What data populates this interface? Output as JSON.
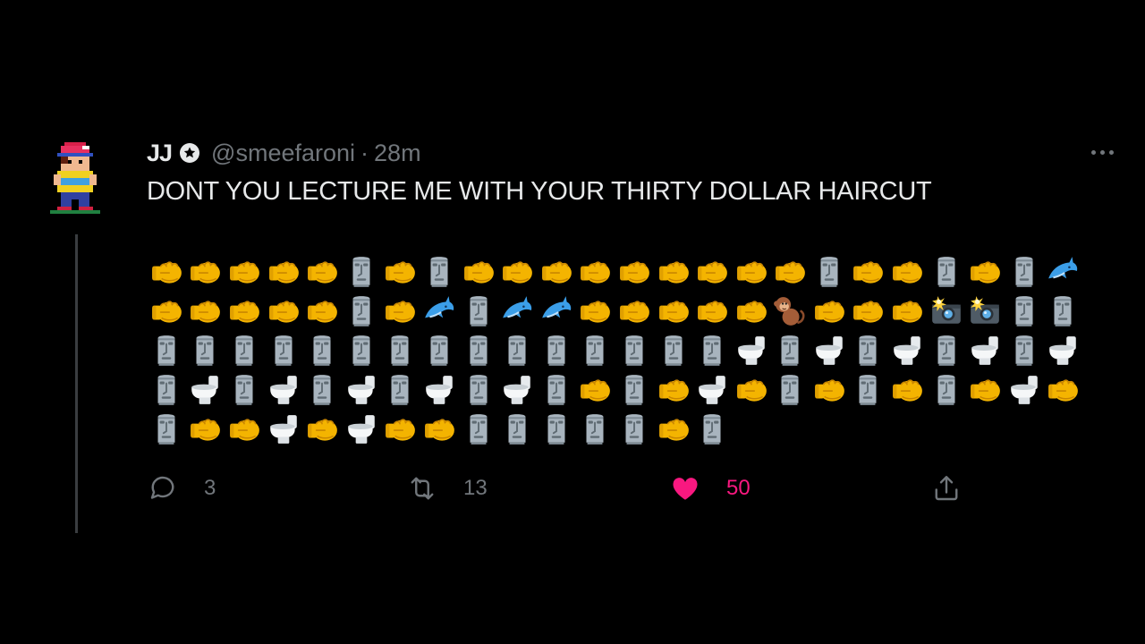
{
  "tweet": {
    "display_name": "JJ",
    "handle": "@smeefaroni",
    "separator": "·",
    "time": "28m",
    "text": "DONT YOU LECTURE ME WITH YOUR THIRTY DOLLAR HAIRCUT",
    "emoji_rows": [
      [
        "fist",
        "fist",
        "fist",
        "fist",
        "fist",
        "moai",
        "fist",
        "moai",
        "fist",
        "fist",
        "fist",
        "fist",
        "fist",
        "fist",
        "fist",
        "fist",
        "fist",
        "moai",
        "fist",
        "fist",
        "moai",
        "fist",
        "moai",
        "dolphin"
      ],
      [
        "fist",
        "fist",
        "fist",
        "fist",
        "fist",
        "moai",
        "fist",
        "dolphin",
        "moai",
        "dolphin",
        "dolphin",
        "fist",
        "fist",
        "fist",
        "fist",
        "fist",
        "monkey",
        "fist",
        "fist",
        "fist",
        "camera-flash",
        "camera-flash",
        "moai",
        "moai"
      ],
      [
        "moai",
        "moai",
        "moai",
        "moai",
        "moai",
        "moai",
        "moai",
        "moai",
        "moai",
        "moai",
        "moai",
        "moai",
        "moai",
        "moai",
        "moai",
        "toilet",
        "moai",
        "toilet",
        "moai",
        "toilet",
        "moai",
        "toilet",
        "moai",
        "toilet"
      ],
      [
        "moai",
        "toilet",
        "moai",
        "toilet",
        "moai",
        "toilet",
        "moai",
        "toilet",
        "moai",
        "toilet",
        "moai",
        "fist",
        "moai",
        "fist",
        "toilet",
        "fist",
        "moai",
        "fist",
        "moai",
        "fist",
        "moai",
        "fist",
        "toilet",
        "fist"
      ],
      [
        "moai",
        "fist",
        "fist",
        "toilet",
        "fist",
        "toilet",
        "fist",
        "fist",
        "moai",
        "moai",
        "moai",
        "moai",
        "moai",
        "fist",
        "moai"
      ]
    ]
  },
  "actions": {
    "reply_count": "3",
    "retweet_count": "13",
    "like_count": "50"
  },
  "colors": {
    "background": "#000000",
    "muted": "#71767b",
    "like": "#f91880"
  },
  "icons": {
    "reply": "reply-icon",
    "retweet": "retweet-icon",
    "like": "heart-icon",
    "share": "share-icon",
    "more": "more-icon"
  }
}
